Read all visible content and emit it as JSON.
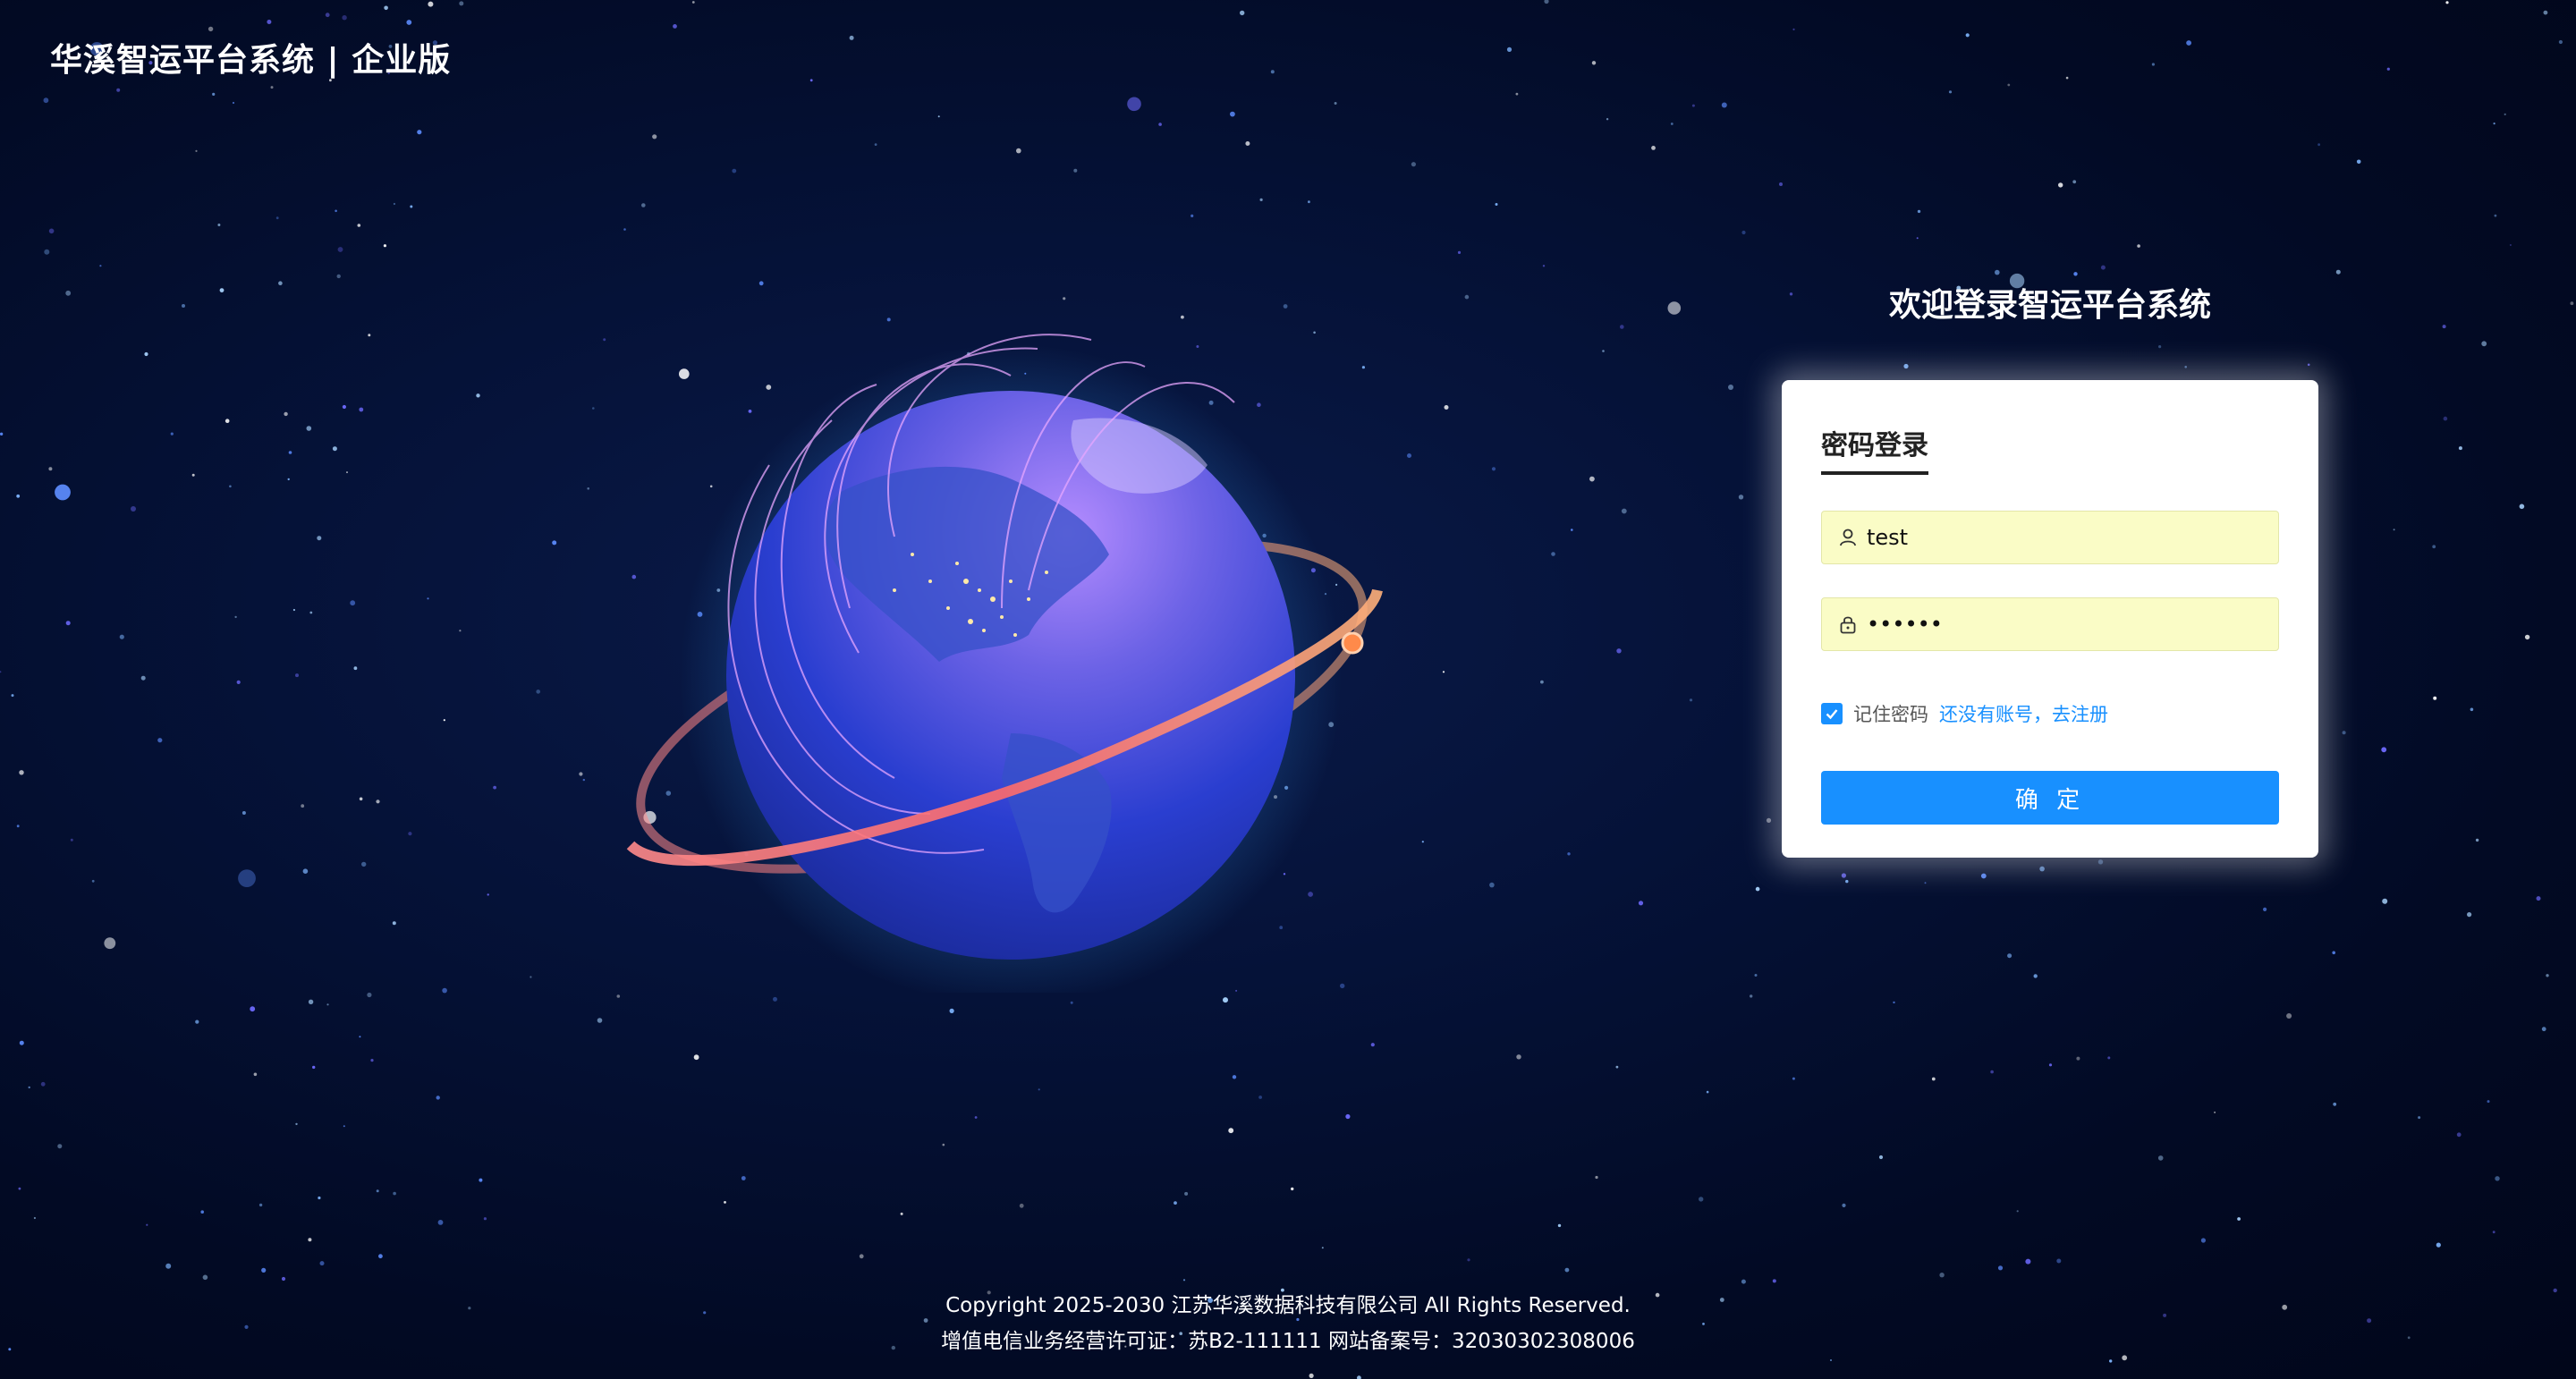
{
  "header": {
    "brand": "华溪智运平台系统 | 企业版"
  },
  "login": {
    "welcome": "欢迎登录智运平台系统",
    "tab_title": "密码登录",
    "username_value": "test",
    "password_value": "••••••",
    "remember_label": "记住密码",
    "no_account_text": "还没有账号，",
    "register_link": "去注册",
    "submit_label": "确 定",
    "remember_checked": true
  },
  "footer": {
    "copyright": "Copyright 2025-2030 江苏华溪数据科技有限公司 All Rights Reserved.",
    "license": "增值电信业务经营许可证：苏B2-111111 网站备案号：32030302308006"
  },
  "colors": {
    "background": "#020a24",
    "primary": "#1890ff",
    "input_fill": "#fafcc6",
    "orbit_ring": "#ff7a7a",
    "arc_lines": "#e7a6ff"
  },
  "icons": {
    "username_field": "user-icon",
    "password_field": "lock-icon",
    "remember": "check-icon"
  }
}
